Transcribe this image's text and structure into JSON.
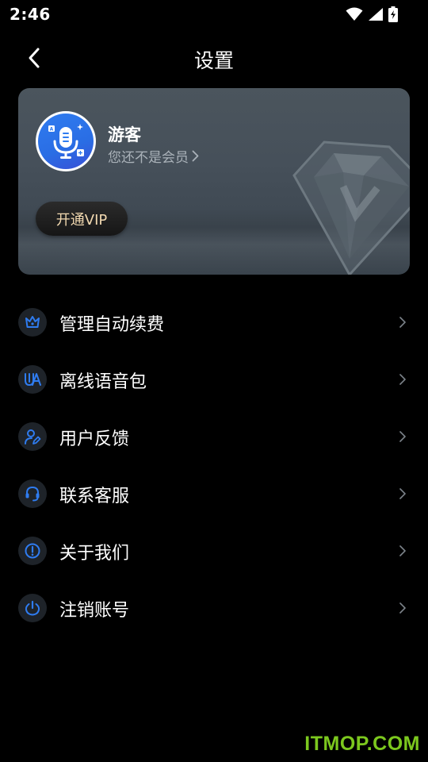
{
  "status_bar": {
    "time": "2:46",
    "icons": [
      "wifi-icon",
      "signal-icon",
      "battery-charging-icon"
    ]
  },
  "header": {
    "title": "设置",
    "back_icon": "back-arrow-icon"
  },
  "profile": {
    "name": "游客",
    "member_status": "您还不是会员",
    "vip_button": "开通VIP",
    "avatar_icon": "microphone-icon"
  },
  "menu": {
    "items": [
      {
        "label": "管理自动续费",
        "icon": "crown-icon"
      },
      {
        "label": "离线语音包",
        "icon": "voice-pack-icon"
      },
      {
        "label": "用户反馈",
        "icon": "user-edit-icon"
      },
      {
        "label": "联系客服",
        "icon": "headset-icon"
      },
      {
        "label": "关于我们",
        "icon": "info-exclamation-icon"
      },
      {
        "label": "注销账号",
        "icon": "power-icon"
      }
    ]
  },
  "watermark": "ITMOP.COM",
  "colors": {
    "background": "#000000",
    "accent_blue": "#2f7cf0",
    "vip_text": "#f2d9b0",
    "watermark": "#7cc81e"
  }
}
